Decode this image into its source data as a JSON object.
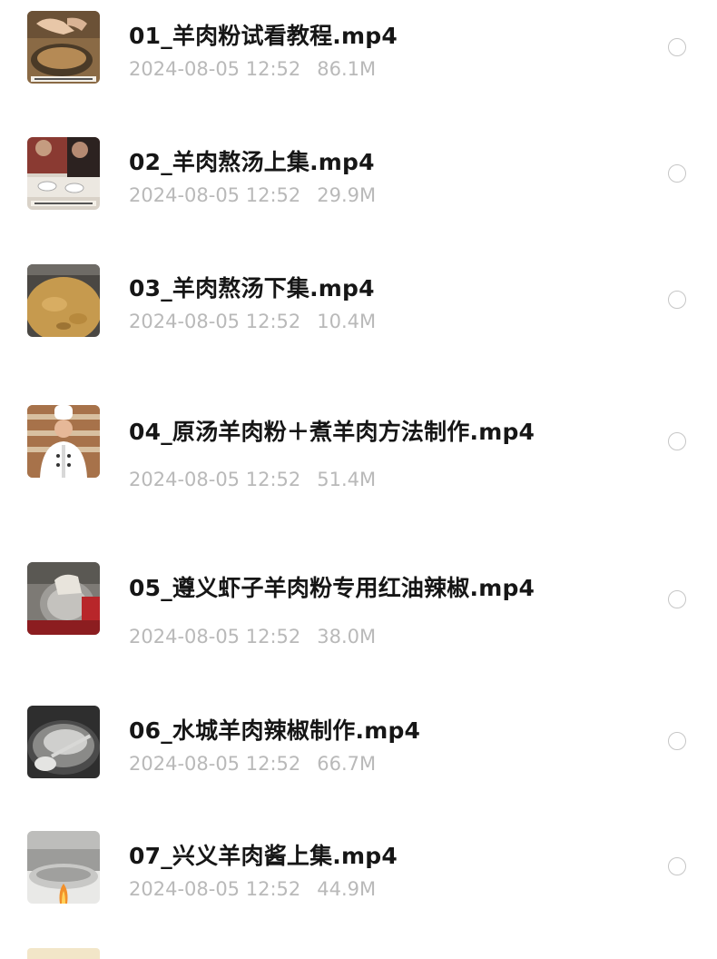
{
  "files": [
    {
      "name": "01_羊肉粉试看教程.mp4",
      "date": "2024-08-05 12:52",
      "size": "86.1M",
      "thumbnail_icon": "video-thumbnail-cooking-pot"
    },
    {
      "name": "02_羊肉熬汤上集.mp4",
      "date": "2024-08-05 12:52",
      "size": "29.9M",
      "thumbnail_icon": "video-thumbnail-kitchen-staff"
    },
    {
      "name": "03_羊肉熬汤下集.mp4",
      "date": "2024-08-05 12:52",
      "size": "10.4M",
      "thumbnail_icon": "video-thumbnail-soup-broth"
    },
    {
      "name": "04_原汤羊肉粉＋煮羊肉方法制作.mp4",
      "date": "2024-08-05 12:52",
      "size": "51.4M",
      "thumbnail_icon": "video-thumbnail-chef"
    },
    {
      "name": "05_遵义虾子羊肉粉专用红油辣椒.mp4",
      "date": "2024-08-05 12:52",
      "size": "38.0M",
      "thumbnail_icon": "video-thumbnail-chili-oil"
    },
    {
      "name": "06_水城羊肉辣椒制作.mp4",
      "date": "2024-08-05 12:52",
      "size": "66.7M",
      "thumbnail_icon": "video-thumbnail-wok-ladle"
    },
    {
      "name": "07_兴义羊肉酱上集.mp4",
      "date": "2024-08-05 12:52",
      "size": "44.9M",
      "thumbnail_icon": "video-thumbnail-stove-fire"
    }
  ],
  "colors": {
    "title": "#161616",
    "meta": "#b9b9b9",
    "radio_border": "#c6c6c6",
    "background": "#ffffff"
  }
}
